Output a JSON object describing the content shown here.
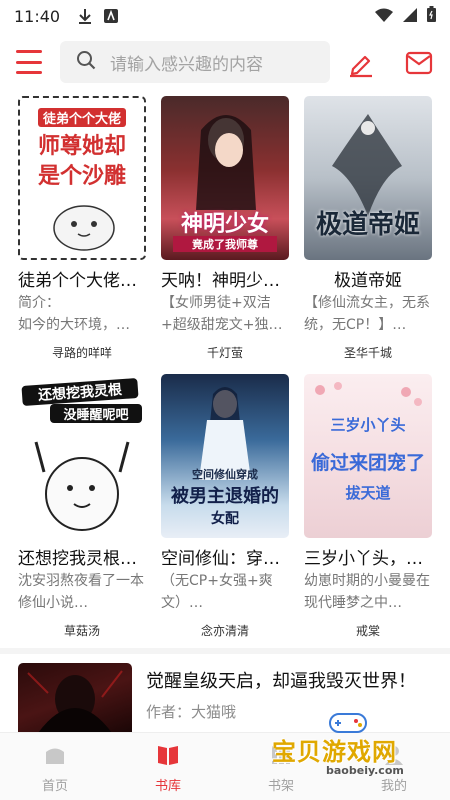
{
  "status_bar": {
    "time": "11:40"
  },
  "search": {
    "placeholder": "请输入感兴趣的内容"
  },
  "books": [
    {
      "title": "徒弟个个大佬…",
      "desc": "简介：\n如今的大环境，…",
      "author": "寻路的咩咩",
      "cover_text": "徒弟个个大佬 师尊她却是个沙雕"
    },
    {
      "title": "天呐！神明少…",
      "desc": "【女师男徒+双洁+超级甜宠文+独…",
      "author": "千灯萤",
      "cover_text": "神明少女 竟成了我师尊"
    },
    {
      "title": "极道帝姬",
      "desc": "【修仙流女主，无系统，无CP！】…",
      "author": "圣华千城",
      "cover_text": "极道帝姬"
    },
    {
      "title": "还想挖我灵根…",
      "desc": "沈安羽熬夜看了一本修仙小说…",
      "author": "草菇汤",
      "cover_text": "还想挖我灵根 没睡醒呢吧"
    },
    {
      "title": "空间修仙：穿…",
      "desc": "（无CP+女强+爽文）…",
      "author": "念亦清清",
      "cover_text": "空间修仙穿成 被男主退婚的 女配"
    },
    {
      "title": "三岁小丫头，…",
      "desc": "幼崽时期的小曼曼在现代睡梦之中…",
      "author": "戒棠",
      "cover_text": "三岁小丫头 偷过来团宠了 拔天道"
    }
  ],
  "featured": {
    "title": "觉醒皇级天启，却逼我毁灭世界！",
    "author": "作者：大猫哦"
  },
  "bottom_nav": [
    {
      "label": "首页",
      "icon": "home-icon",
      "active": false
    },
    {
      "label": "书库",
      "icon": "book-icon",
      "active": true
    },
    {
      "label": "书架",
      "icon": "shelf-icon",
      "active": false
    },
    {
      "label": "我的",
      "icon": "user-icon",
      "active": false
    }
  ],
  "watermark": {
    "text": "宝贝游戏网",
    "url": "baobeiy.com"
  },
  "colors": {
    "accent": "#e6363a",
    "text": "#111111",
    "muted": "#777777"
  }
}
